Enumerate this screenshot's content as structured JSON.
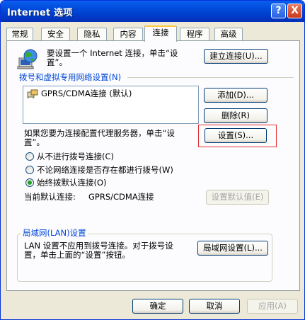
{
  "window": {
    "title": "Internet 选项",
    "help": "?",
    "close": "X"
  },
  "tabs": [
    {
      "label": "常规"
    },
    {
      "label": "安全"
    },
    {
      "label": "隐私"
    },
    {
      "label": "内容"
    },
    {
      "label": "连接"
    },
    {
      "label": "程序"
    },
    {
      "label": "高级"
    }
  ],
  "setup": {
    "text_line1": "要设置一个 Internet 连接，单击“设",
    "text_line2": "置”。",
    "button": "建立连接(U)..."
  },
  "dialup": {
    "section_label": "拨号和虚拟专用网络设置(N)",
    "connections": [
      {
        "name": "GPRS/CDMA连接 (默认)"
      }
    ],
    "add_button": "添加(D)...",
    "remove_button": "删除(R)",
    "proxy_text_line1": "如果您要为连接配置代理服务器，单击“设",
    "proxy_text_line2": "置”。",
    "settings_button": "设置(S)...",
    "options": [
      {
        "label": "从不进行拨号连接(C)",
        "selected": false
      },
      {
        "label": "不论网络连接是否存在都进行拨号(W)",
        "selected": false
      },
      {
        "label": "始终拨默认连接(O)",
        "selected": true
      }
    ],
    "default_label": "当前默认连接:",
    "default_value": "GPRS/CDMA连接",
    "set_default_button": "设置默认值(E)"
  },
  "lan": {
    "group_label": "局域网(LAN)设置",
    "text_line1": "LAN 设置不应用到拨号连接。对于拨号设",
    "text_line2": "置，单击上面的“设置”按钮。",
    "button": "局域网设置(L)..."
  },
  "footer": {
    "ok": "确定",
    "cancel": "取消",
    "apply": "应用(A)"
  },
  "colors": {
    "titlebar": "#0047d6",
    "highlight_box": "#e03030",
    "selected_radio": "#21a121"
  }
}
